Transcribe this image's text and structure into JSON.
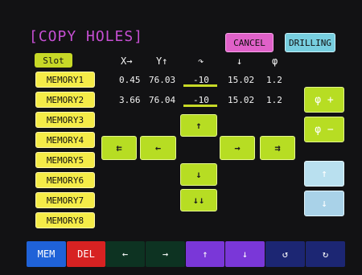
{
  "title": "[COPY HOLES]",
  "buttons": {
    "cancel": "CANCEL",
    "drilling": "DRILLING",
    "slot": "Slot"
  },
  "memories": [
    "MEMORY1",
    "MEMORY2",
    "MEMORY3",
    "MEMORY4",
    "MEMORY5",
    "MEMORY6",
    "MEMORY7",
    "MEMORY8"
  ],
  "headers": {
    "x": "X→",
    "y": "Y↑",
    "rot": "↷",
    "down": "↓",
    "phi": "φ"
  },
  "rows": [
    {
      "x": "0.45",
      "y": "76.03",
      "rot": "-10",
      "down": "15.02",
      "phi": "1.2"
    },
    {
      "x": "3.66",
      "y": "76.04",
      "rot": "-10",
      "down": "15.02",
      "phi": "1.2"
    }
  ],
  "arrows": {
    "up": "↑",
    "left_double": "⇇",
    "left": "←",
    "right": "→",
    "right_double": "⇉",
    "down": "↓",
    "down_double": "↓↓"
  },
  "right_panel": {
    "phi_plus": "φ +",
    "phi_minus": "φ −",
    "up": "↑",
    "down": "↓"
  },
  "bottom_bar": {
    "mem": "MEM",
    "del": "DEL",
    "left": "←",
    "right": "→",
    "up": "↑",
    "down": "↓",
    "ccw": "↺",
    "cw": "↻"
  }
}
